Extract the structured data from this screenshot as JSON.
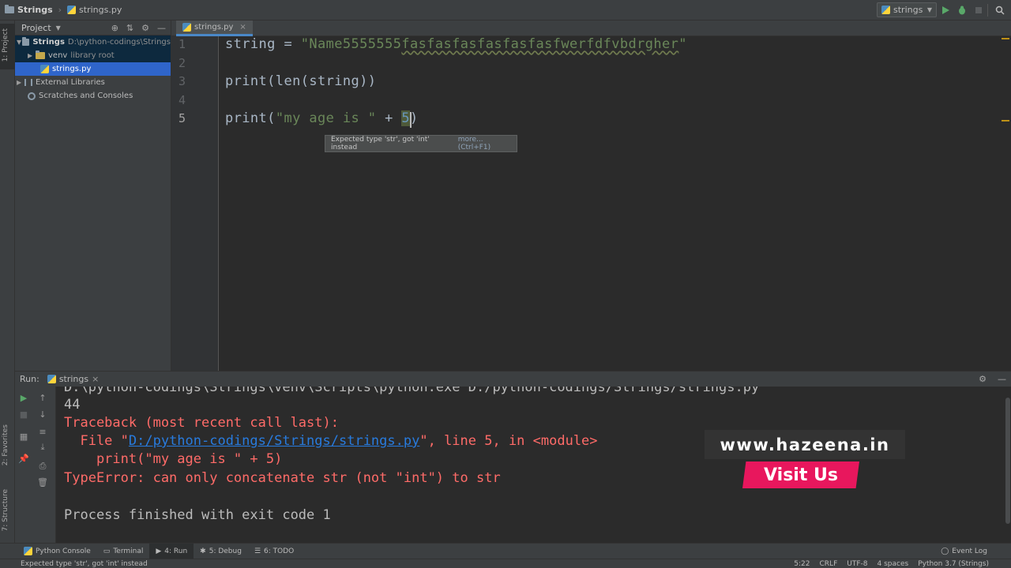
{
  "breadcrumb": {
    "project": "Strings",
    "file": "strings.py"
  },
  "run_config": {
    "name": "strings"
  },
  "left_strip": {
    "project_label": "1: Project",
    "favorites_label": "2: Favorites",
    "structure_label": "7: Structure"
  },
  "project_panel": {
    "title": "Project",
    "tree": [
      {
        "label": "Strings",
        "hint": "D:\\python-codings\\Strings"
      },
      {
        "label": "venv",
        "hint": "library root"
      },
      {
        "label": "strings.py",
        "hint": ""
      },
      {
        "label": "External Libraries",
        "hint": ""
      },
      {
        "label": "Scratches and Consoles",
        "hint": ""
      }
    ]
  },
  "editor": {
    "tab": "strings.py",
    "line_numbers": [
      "1",
      "2",
      "3",
      "4",
      "5"
    ],
    "line1": {
      "var": "string = ",
      "str": "\"Name5555555",
      "str_warn": "fasfasfasfasfasfasfwerfdfvbdrgher",
      "str_end": "\""
    },
    "line3": "print(len(string))",
    "line5": {
      "pre": "print(",
      "str": "\"my age is \"",
      "op": " + ",
      "num": "5",
      "post": ")"
    },
    "tooltip": {
      "text": "Expected type 'str', got 'int' instead",
      "more": "more... (Ctrl+F1)"
    }
  },
  "run_panel": {
    "label": "Run:",
    "tab": "strings",
    "console": {
      "cmd": "D:\\python-codings\\Strings\\venv\\Scripts\\python.exe D:/python-codings/Strings/strings.py",
      "out": "44",
      "tb1": "Traceback (most recent call last):",
      "tb2_pre": "  File \"",
      "tb2_link": "D:/python-codings/Strings/strings.py",
      "tb2_post": "\", line 5, in <module>",
      "tb3": "    print(\"my age is \" + 5)",
      "tb4": "TypeError: can only concatenate str (not \"int\") to str",
      "exit": "Process finished with exit code 1"
    }
  },
  "promo": {
    "url": "www.hazeena.in",
    "button": "Visit Us"
  },
  "bottom_tools": [
    "Python Console",
    "Terminal",
    "4: Run",
    "5: Debug",
    "6: TODO"
  ],
  "event_log": "Event Log",
  "status": {
    "message": "Expected type 'str', got 'int' instead",
    "position": "5:22",
    "line_sep": "CRLF",
    "encoding": "UTF-8",
    "indent": "4 spaces",
    "interpreter": "Python 3.7 (Strings)"
  }
}
